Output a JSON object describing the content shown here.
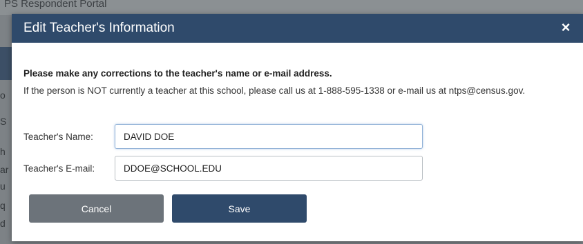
{
  "background": {
    "portal_title": "PS Respondent Portal",
    "side_fragments": [
      "o",
      "S",
      "h",
      "ar",
      "u",
      "q",
      "d"
    ]
  },
  "modal": {
    "title": "Edit Teacher's Information",
    "close_glyph": "×",
    "instruction_bold": "Please make any corrections to the teacher's name or e-mail address.",
    "instruction_text": "If the person is NOT currently a teacher at this school, please call us at 1-888-595-1338 or e-mail us at ntps@census.gov.",
    "fields": {
      "name_label": "Teacher's Name:",
      "name_value": "DAVID DOE",
      "email_label": "Teacher's E-mail:",
      "email_value": "DDOE@SCHOOL.EDU"
    },
    "buttons": {
      "cancel_label": "Cancel",
      "save_label": "Save"
    }
  },
  "colors": {
    "header": "#2f4a6b",
    "cancel": "#6c737a",
    "save": "#2f4a6b"
  }
}
